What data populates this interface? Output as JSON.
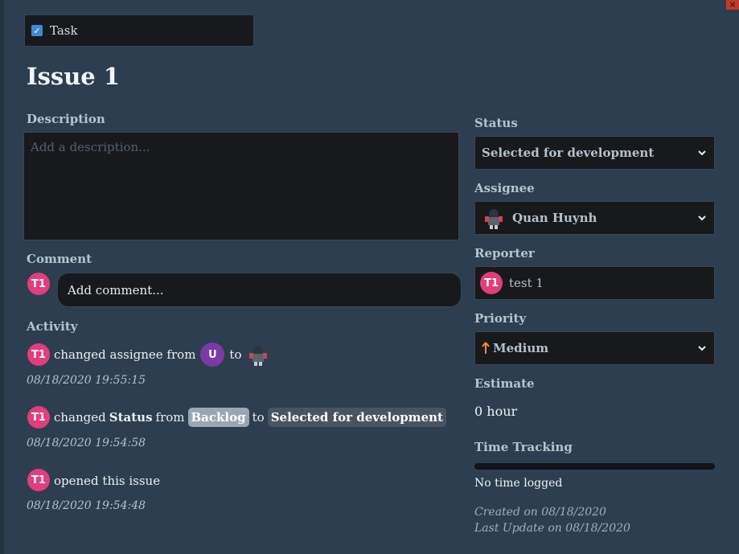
{
  "window": {
    "close_glyph": "×"
  },
  "issue": {
    "type": "Task",
    "title": "Issue 1"
  },
  "description": {
    "label": "Description",
    "placeholder": "Add a description..."
  },
  "comment": {
    "label": "Comment",
    "user_initials": "T1",
    "placeholder": "Add comment..."
  },
  "activity": {
    "label": "Activity",
    "items": [
      {
        "initials": "T1",
        "action": "changed assignee from",
        "from_initial": "U",
        "to_word": "to",
        "time": "08/18/2020 19:55:15"
      },
      {
        "initials": "T1",
        "action": "changed",
        "field": "Status",
        "from_word": "from",
        "from_value": "Backlog",
        "to_word": "to",
        "to_value": "Selected for development",
        "time": "08/18/2020 19:54:58"
      },
      {
        "initials": "T1",
        "action": "opened this issue",
        "time": "08/18/2020 19:54:48"
      }
    ]
  },
  "sidebar": {
    "status": {
      "label": "Status",
      "value": "Selected for development"
    },
    "assignee": {
      "label": "Assignee",
      "value": "Quan Huynh"
    },
    "reporter": {
      "label": "Reporter",
      "initials": "T1",
      "value": "test 1"
    },
    "priority": {
      "label": "Priority",
      "value": "Medium",
      "icon": "arrow-up-icon",
      "icon_color": "#f08c2a"
    },
    "estimate": {
      "label": "Estimate",
      "value": "0 hour"
    },
    "time_tracking": {
      "label": "Time Tracking",
      "progress": 0,
      "text": "No time logged"
    },
    "created": "Created on 08/18/2020",
    "updated": "Last Update on 08/18/2020"
  },
  "colors": {
    "background": "#2c3e50",
    "input_bg": "#17191d",
    "avatar_pink": "#e33d7b",
    "avatar_purple": "#7b3aa6",
    "checkbox_blue": "#3c8bd9"
  }
}
